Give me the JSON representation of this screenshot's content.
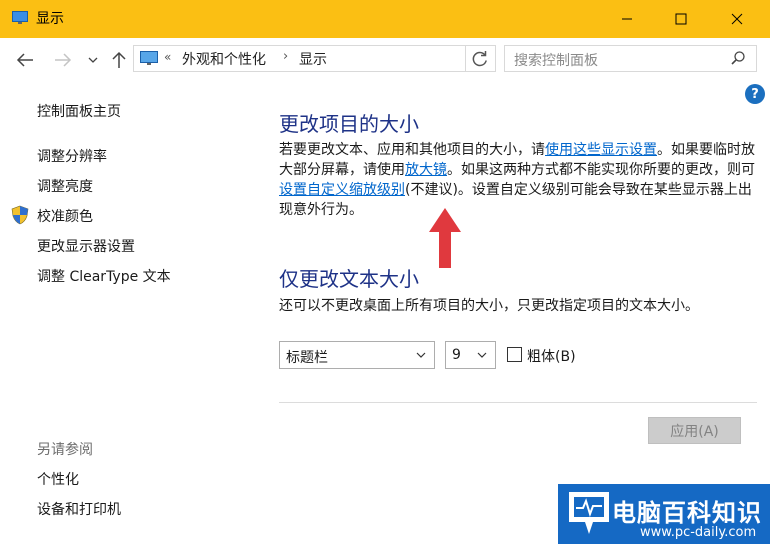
{
  "window": {
    "title": "显示",
    "accent": "#fbbf13"
  },
  "nav": {
    "breadcrumb": [
      "外观和个性化",
      "显示"
    ],
    "chevron": "«",
    "separator": "›",
    "search_placeholder": "搜索控制面板"
  },
  "help": {
    "label": "?"
  },
  "sidebar": {
    "home": "控制面板主页",
    "items": [
      "调整分辨率",
      "调整亮度",
      "校准颜色",
      "更改显示器设置",
      "调整 ClearType 文本"
    ],
    "see_also_title": "另请参阅",
    "see_also": [
      "个性化",
      "设备和打印机"
    ]
  },
  "main": {
    "heading1": "更改项目的大小",
    "para1": {
      "t1": "若要更改文本、应用和其他项目的大小，请",
      "link1": "使用这些显示设置",
      "t2": "。如果要临时放大部分屏幕，请使用",
      "link2": "放大镜",
      "t3": "。如果这两种方式都不能实现你所要的更改，则可",
      "link3": "设置自定义缩放级别",
      "t4": "(不建议)。设置自定义级别可能会导致在某些显示器上出现意外行为。"
    },
    "heading2": "仅更改文本大小",
    "para2": "还可以不更改桌面上所有项目的大小，只更改指定项目的文本大小。",
    "item_select": "标题栏",
    "size_select": "9",
    "bold_label": "粗体(B)",
    "bold_checked": false,
    "apply_label": "应用(A)"
  },
  "watermark": {
    "title": "电脑百科知识",
    "url": "www.pc-daily.com"
  },
  "colors": {
    "link": "#0066cc",
    "heading": "#1e3287",
    "annotation_arrow": "#e0393e",
    "watermark_bg": "#1569c4"
  }
}
